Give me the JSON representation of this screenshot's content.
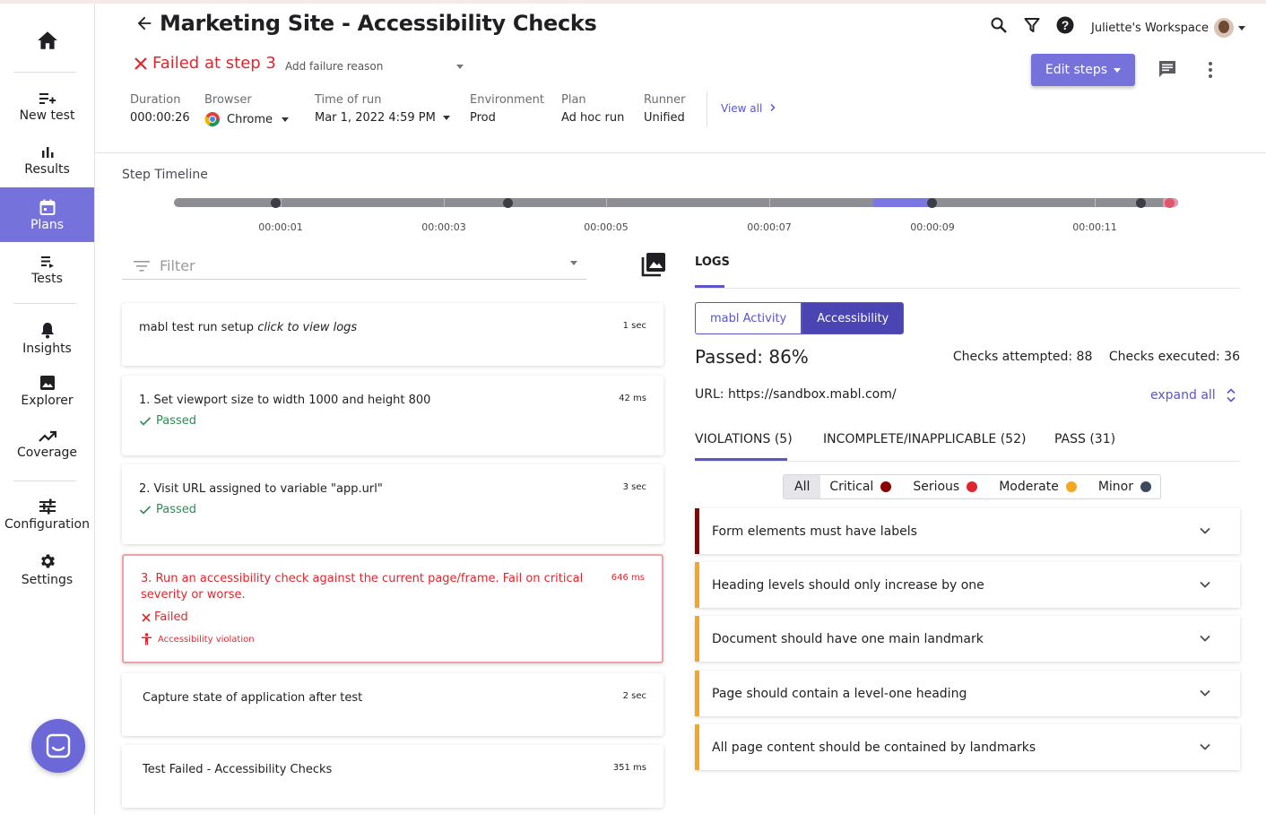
{
  "sidebar": {
    "items": [
      {
        "label": "New test",
        "icon": "playlist-add-icon"
      },
      {
        "label": "Results",
        "icon": "bar-chart-icon"
      },
      {
        "label": "Plans",
        "icon": "calendar-icon"
      },
      {
        "label": "Tests",
        "icon": "list-play-icon"
      },
      {
        "label": "Insights",
        "icon": "bell-icon"
      },
      {
        "label": "Explorer",
        "icon": "image-icon"
      },
      {
        "label": "Coverage",
        "icon": "trend-icon"
      },
      {
        "label": "Configuration",
        "icon": "sliders-icon"
      },
      {
        "label": "Settings",
        "icon": "gear-icon"
      }
    ],
    "active": "Plans",
    "accent": "#7672db"
  },
  "header": {
    "title": "Marketing Site - Accessibility Checks",
    "workspace": "Juliette's Workspace",
    "fail_status": "Failed at step 3",
    "failure_reason_placeholder": "Add failure reason",
    "edit_steps": "Edit steps",
    "view_all": "View all",
    "meta": [
      {
        "label": "Duration",
        "value": "000:00:26"
      },
      {
        "label": "Browser",
        "value": "Chrome"
      },
      {
        "label": "Time of run",
        "value": "Mar 1, 2022 4:59 PM"
      },
      {
        "label": "Environment",
        "value": "Prod"
      },
      {
        "label": "Plan",
        "value": "Ad hoc run"
      },
      {
        "label": "Runner",
        "value": "Unified"
      }
    ]
  },
  "timeline": {
    "label": "Step Timeline",
    "ticks": [
      "00:00:01",
      "00:00:03",
      "00:00:05",
      "00:00:07",
      "00:00:09",
      "00:00:11"
    ]
  },
  "filter": {
    "placeholder": "Filter"
  },
  "steps": [
    {
      "title_main": "mabl test run setup",
      "title_italic": "click to view logs",
      "duration": "1 sec"
    },
    {
      "title": "1. Set viewport size to width 1000 and height 800",
      "duration": "42 ms",
      "status": "Passed"
    },
    {
      "title": "2. Visit URL assigned to variable \"app.url\"",
      "duration": "3 sec",
      "status": "Passed"
    },
    {
      "title": "3. Run an accessibility check against the current page/frame. Fail on critical severity or worse.",
      "duration": "646 ms",
      "status": "Failed",
      "tag": "Accessibility violation"
    },
    {
      "title": "Capture state of application after test",
      "duration": "2 sec"
    },
    {
      "title": "Test Failed - Accessibility Checks",
      "duration": "351 ms"
    }
  ],
  "logs": {
    "tab": "LOGS",
    "segments": [
      "mabl Activity",
      "Accessibility"
    ],
    "passed": "Passed: 86%",
    "checks_attempted": "Checks attempted: 88",
    "checks_executed": "Checks executed: 36",
    "url": "URL: https://sandbox.mabl.com/",
    "expand_all": "expand all",
    "tabs": [
      "VIOLATIONS (5)",
      "INCOMPLETE/INAPPLICABLE (52)",
      "PASS (31)"
    ],
    "severities": [
      {
        "label": "All"
      },
      {
        "label": "Critical",
        "color": "#8b0000"
      },
      {
        "label": "Serious",
        "color": "#e0262d"
      },
      {
        "label": "Moderate",
        "color": "#f5a623"
      },
      {
        "label": "Minor",
        "color": "#3d4a5c"
      }
    ],
    "violations": [
      {
        "title": "Form elements must have labels",
        "color": "#8b0000"
      },
      {
        "title": "Heading levels should only increase by one",
        "color": "#f5a623"
      },
      {
        "title": "Document should have one main landmark",
        "color": "#f5a623"
      },
      {
        "title": "Page should contain a level-one heading",
        "color": "#f5a623"
      },
      {
        "title": "All page content should be contained by landmarks",
        "color": "#f5a623"
      }
    ]
  }
}
